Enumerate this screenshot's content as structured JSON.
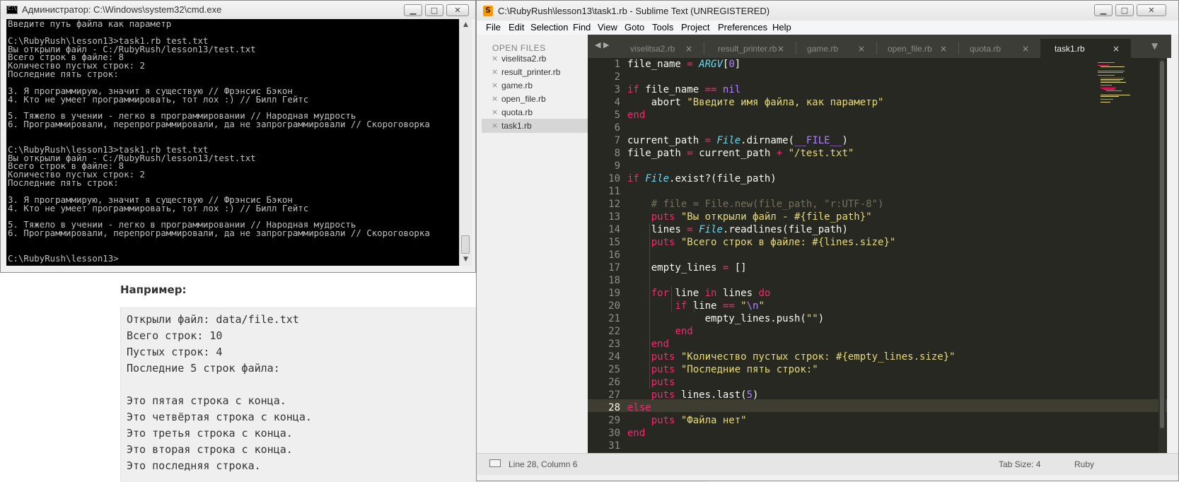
{
  "webpage": {
    "example_label": "Например:",
    "example_lines": [
      "Открыли файл: data/file.txt",
      "Всего строк: 10",
      "Пустых строк: 4",
      "Последние 5 строк файла:",
      "",
      "Это пятая строка с конца.",
      "Это четвёртая строка с конца.",
      "Это третья строка с конца.",
      "Это вторая строка с конца.",
      "Это последняя строка."
    ]
  },
  "cmd": {
    "title": "Администратор: C:\\Windows\\system32\\cmd.exe",
    "buttons": {
      "minimize": "▁",
      "maximize": "□",
      "close": "✕"
    },
    "lines": [
      "Введите путь файла как параметр",
      "",
      "C:\\RubyRush\\lesson13>task1.rb test.txt",
      "Вы открыли файл - C:/RubyRush/lesson13/test.txt",
      "Всего строк в файле: 8",
      "Количество пустых строк: 2",
      "Последние пять строк:",
      "",
      "3. Я программирую, значит я существую // Фрэнсис Бэкон",
      "4. Кто не умеет программировать, тот лох :) // Билл Гейтс",
      "",
      "5. Тяжело в учении - легко в программировании // Народная мудрость",
      "6. Программировали, перепрограммировали, да не запрограммировали // Скороговорка",
      "",
      "",
      "C:\\RubyRush\\lesson13>task1.rb test.txt",
      "Вы открыли файл - C:/RubyRush/lesson13/test.txt",
      "Всего строк в файле: 8",
      "Количество пустых строк: 2",
      "Последние пять строк:",
      "",
      "3. Я программирую, значит я существую // Фрэнсис Бэкон",
      "4. Кто не умеет программировать, тот лох :) // Билл Гейтс",
      "",
      "5. Тяжело в учении - легко в программировании // Народная мудрость",
      "6. Программировали, перепрограммировали, да не запрограммировали // Скороговорка",
      "",
      "",
      "C:\\RubyRush\\lesson13>"
    ]
  },
  "sublime": {
    "title": "C:\\RubyRush\\lesson13\\task1.rb - Sublime Text (UNREGISTERED)",
    "menu": [
      {
        "label": "File"
      },
      {
        "label": "Edit"
      },
      {
        "label": "Selection"
      },
      {
        "label": "Find"
      },
      {
        "label": "View"
      },
      {
        "label": "Goto"
      },
      {
        "label": "Tools"
      },
      {
        "label": "Project"
      },
      {
        "label": "Preferences"
      },
      {
        "label": "Help"
      }
    ],
    "sidebar": {
      "header": "OPEN FILES",
      "files": [
        {
          "name": "viselitsa2.rb"
        },
        {
          "name": "result_printer.rb"
        },
        {
          "name": "game.rb"
        },
        {
          "name": "open_file.rb"
        },
        {
          "name": "quota.rb"
        },
        {
          "name": "task1.rb"
        }
      ],
      "close_glyph": "×"
    },
    "tabs": [
      {
        "label": "viselitsa2.rb"
      },
      {
        "label": "result_printer.rb"
      },
      {
        "label": "game.rb"
      },
      {
        "label": "open_file.rb"
      },
      {
        "label": "quota.rb"
      },
      {
        "label": "task1.rb"
      }
    ],
    "tab_close_glyph": "×",
    "tab_nav": "◀ ▶",
    "tab_dropdown": "▼",
    "line_numbers": [
      "1",
      "2",
      "3",
      "4",
      "5",
      "6",
      "7",
      "8",
      "9",
      "10",
      "11",
      "12",
      "13",
      "14",
      "15",
      "16",
      "17",
      "18",
      "19",
      "20",
      "21",
      "22",
      "23",
      "24",
      "25",
      "26",
      "27",
      "28",
      "29",
      "30",
      "31"
    ],
    "current_line": "28",
    "status": {
      "position": "Line 28, Column 6",
      "tab_size": "Tab Size: 4",
      "syntax": "Ruby"
    },
    "colors": {
      "editor_bg": "#272822",
      "keyword": "#f92672",
      "string": "#e6db74",
      "number": "#ae81ff",
      "comment": "#75715e",
      "constant": "#66d9ef"
    }
  }
}
